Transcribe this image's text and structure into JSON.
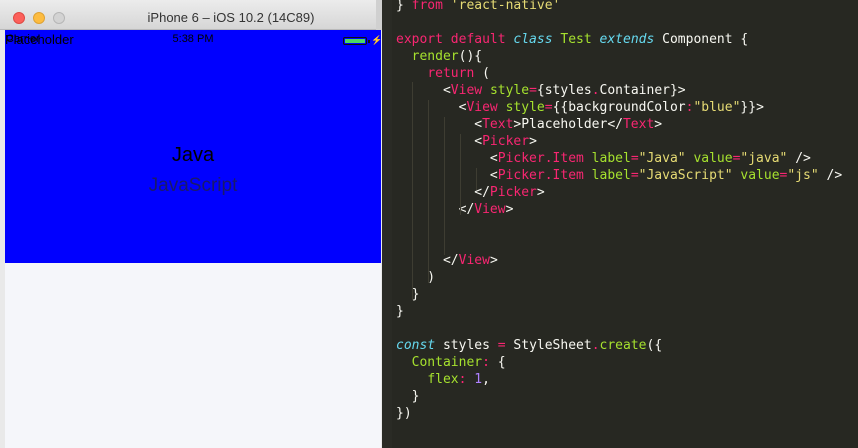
{
  "simulator": {
    "window_title": "iPhone 6 – iOS 10.2 (14C89)",
    "statusbar": {
      "carrier": "Carrier",
      "time": "5:38 PM"
    },
    "app": {
      "text": "Placeholder",
      "background_color": "#0000ff",
      "picker": {
        "items": [
          "Java",
          "JavaScript"
        ],
        "selected": "Java"
      }
    }
  },
  "editor": {
    "lines": [
      {
        "parts": [
          [
            "plain",
            "} "
          ],
          [
            "kw",
            "from "
          ],
          [
            "st",
            "'react-native'"
          ]
        ]
      },
      {
        "parts": []
      },
      {
        "parts": [
          [
            "kw",
            "export default "
          ],
          [
            "it",
            "class "
          ],
          [
            "fn",
            "Test "
          ],
          [
            "it",
            "extends "
          ],
          [
            "plain",
            "Component {"
          ]
        ]
      },
      {
        "parts": [
          [
            "plain",
            "  "
          ],
          [
            "fn",
            "render"
          ],
          [
            "plain",
            "(){"
          ]
        ]
      },
      {
        "parts": [
          [
            "plain",
            "    "
          ],
          [
            "kw",
            "return "
          ],
          [
            "plain",
            "("
          ]
        ]
      },
      {
        "parts": [
          [
            "plain",
            "      <"
          ],
          [
            "tag",
            "View "
          ],
          [
            "attr",
            "style"
          ],
          [
            "kw",
            "="
          ],
          [
            "plain",
            "{styles"
          ],
          [
            "kw",
            "."
          ],
          [
            "plain",
            "Container}>"
          ]
        ]
      },
      {
        "parts": [
          [
            "plain",
            "        <"
          ],
          [
            "tag",
            "View "
          ],
          [
            "attr",
            "style"
          ],
          [
            "kw",
            "="
          ],
          [
            "plain",
            "{{backgroundColor"
          ],
          [
            "kw",
            ":"
          ],
          [
            "st",
            "\"blue\""
          ],
          [
            "plain",
            "}}>"
          ]
        ]
      },
      {
        "parts": [
          [
            "plain",
            "          <"
          ],
          [
            "tag",
            "Text"
          ],
          [
            "plain",
            ">Placeholder</"
          ],
          [
            "tag",
            "Text"
          ],
          [
            "plain",
            ">"
          ]
        ]
      },
      {
        "parts": [
          [
            "plain",
            "          <"
          ],
          [
            "tag",
            "Picker"
          ],
          [
            "plain",
            ">"
          ]
        ]
      },
      {
        "parts": [
          [
            "plain",
            "            <"
          ],
          [
            "tag",
            "Picker.Item "
          ],
          [
            "attr",
            "label"
          ],
          [
            "kw",
            "="
          ],
          [
            "st",
            "\"Java\" "
          ],
          [
            "attr",
            "value"
          ],
          [
            "kw",
            "="
          ],
          [
            "st",
            "\"java\" "
          ],
          [
            "plain",
            "/>"
          ]
        ]
      },
      {
        "parts": [
          [
            "plain",
            "            <"
          ],
          [
            "tag",
            "Picker.Item "
          ],
          [
            "attr",
            "label"
          ],
          [
            "kw",
            "="
          ],
          [
            "st",
            "\"JavaScript\" "
          ],
          [
            "attr",
            "value"
          ],
          [
            "kw",
            "="
          ],
          [
            "st",
            "\"js\" "
          ],
          [
            "plain",
            "/>"
          ]
        ]
      },
      {
        "parts": [
          [
            "plain",
            "          </"
          ],
          [
            "tag",
            "Picker"
          ],
          [
            "plain",
            ">"
          ]
        ]
      },
      {
        "parts": [
          [
            "plain",
            "        </"
          ],
          [
            "tag",
            "View"
          ],
          [
            "plain",
            ">"
          ]
        ]
      },
      {
        "parts": []
      },
      {
        "parts": []
      },
      {
        "parts": [
          [
            "plain",
            "      </"
          ],
          [
            "tag",
            "View"
          ],
          [
            "plain",
            ">"
          ]
        ]
      },
      {
        "parts": [
          [
            "plain",
            "    )"
          ]
        ]
      },
      {
        "parts": [
          [
            "plain",
            "  }"
          ]
        ]
      },
      {
        "parts": [
          [
            "plain",
            "}"
          ]
        ]
      },
      {
        "parts": []
      },
      {
        "parts": [
          [
            "it",
            "const "
          ],
          [
            "plain",
            "styles "
          ],
          [
            "kw",
            "= "
          ],
          [
            "plain",
            "StyleSheet"
          ],
          [
            "kw",
            "."
          ],
          [
            "fn",
            "create"
          ],
          [
            "plain",
            "({"
          ]
        ]
      },
      {
        "parts": [
          [
            "plain",
            "  "
          ],
          [
            "fn",
            "Container"
          ],
          [
            "kw",
            ": "
          ],
          [
            "plain",
            "{"
          ]
        ]
      },
      {
        "parts": [
          [
            "plain",
            "    "
          ],
          [
            "fn",
            "flex"
          ],
          [
            "kw",
            ": "
          ],
          [
            "num",
            "1"
          ],
          [
            "plain",
            ","
          ]
        ]
      },
      {
        "parts": [
          [
            "plain",
            "  }"
          ]
        ]
      },
      {
        "parts": [
          [
            "plain",
            "})"
          ]
        ]
      }
    ]
  }
}
